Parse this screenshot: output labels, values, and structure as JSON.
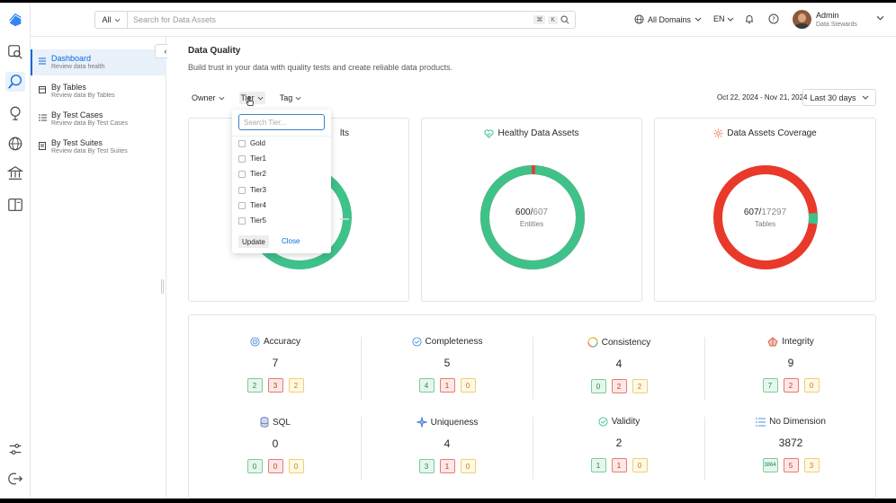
{
  "topbar": {
    "search_scope": "All",
    "search_placeholder": "Search for Data Assets",
    "shortcut_key": "⌘",
    "shortcut_key2": "K",
    "domains_label": "All Domains",
    "language": "EN",
    "user_name": "Admin",
    "user_role": "Data Stewards"
  },
  "menu": {
    "items": [
      {
        "title": "Dashboard",
        "subtitle": "Review data health",
        "icon": "dashboard-icon"
      },
      {
        "title": "By Tables",
        "subtitle": "Review data By Tables",
        "icon": "table-icon"
      },
      {
        "title": "By Test Cases",
        "subtitle": "Review data By Test Cases",
        "icon": "test-case-icon"
      },
      {
        "title": "By Test Suites",
        "subtitle": "Review data By Test Suites",
        "icon": "test-suite-icon"
      }
    ],
    "collapse_label": "‹›"
  },
  "page": {
    "title": "Data Quality",
    "subtitle": "Build trust in your data with quality tests and create reliable data products."
  },
  "filters": {
    "owner": "Owner",
    "tier": "Tier",
    "tag": "Tag",
    "date_range": "Oct 22, 2024 - Nov 21, 2024",
    "date_preset": "Last 30 days"
  },
  "tier_dropdown": {
    "placeholder": "Search Tier...",
    "options": [
      "Gold",
      "Tier1",
      "Tier2",
      "Tier3",
      "Tier4",
      "Tier5"
    ],
    "update_label": "Update",
    "close_label": "Close"
  },
  "summary_cards": [
    {
      "title": "Test Case Results",
      "title_visible": "lts",
      "numerator": "",
      "denominator": "",
      "unit": "",
      "success_fraction": 0.99,
      "colors": {
        "ok": "#3fc18a",
        "fail": "#e8392b"
      }
    },
    {
      "title": "Healthy Data Assets",
      "numerator": "600",
      "denominator": "607",
      "unit": "Entities",
      "success_fraction": 0.988,
      "colors": {
        "ok": "#3fc18a",
        "fail": "#e8392b"
      }
    },
    {
      "title": "Data Assets Coverage",
      "numerator": "607",
      "denominator": "17297",
      "unit": "Tables",
      "success_fraction": 0.035,
      "colors": {
        "ok": "#3fc18a",
        "fail": "#e8392b"
      }
    }
  ],
  "dimensions": [
    {
      "name": "Accuracy",
      "value": "7",
      "success": "2",
      "failed": "3",
      "aborted": "2",
      "icon": "accuracy-icon"
    },
    {
      "name": "Completeness",
      "value": "5",
      "success": "4",
      "failed": "1",
      "aborted": "0",
      "icon": "completeness-icon"
    },
    {
      "name": "Consistency",
      "value": "4",
      "success": "0",
      "failed": "2",
      "aborted": "2",
      "icon": "consistency-icon"
    },
    {
      "name": "Integrity",
      "value": "9",
      "success": "7",
      "failed": "2",
      "aborted": "0",
      "icon": "integrity-icon"
    },
    {
      "name": "SQL",
      "value": "0",
      "success": "0",
      "failed": "0",
      "aborted": "0",
      "icon": "sql-icon"
    },
    {
      "name": "Uniqueness",
      "value": "4",
      "success": "3",
      "failed": "1",
      "aborted": "0",
      "icon": "uniqueness-icon"
    },
    {
      "name": "Validity",
      "value": "2",
      "success": "1",
      "failed": "1",
      "aborted": "0",
      "icon": "validity-icon"
    },
    {
      "name": "No Dimension",
      "value": "3872",
      "success": "3864",
      "failed": "5",
      "aborted": "3",
      "icon": "no-dimension-icon"
    }
  ]
}
